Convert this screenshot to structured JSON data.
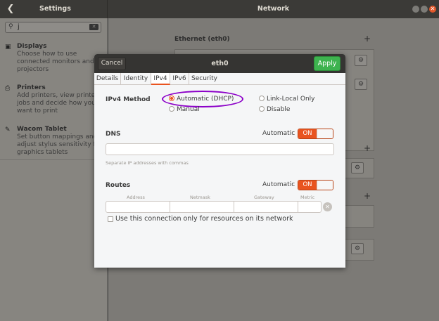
{
  "titlebar": {
    "settings_title": "Settings",
    "network_title": "Network",
    "back_icon": "chevron-left-icon"
  },
  "sidebar": {
    "search_value": "j",
    "items": [
      {
        "name": "Displays",
        "desc": "Choose how to use\nconnected monitors and\nprojectors",
        "icon": "display-icon"
      },
      {
        "name": "Printers",
        "desc": "Add printers, view printer\njobs and decide how you\nwant to print",
        "icon": "printer-icon"
      },
      {
        "name": "Wacom Tablet",
        "desc": "Set button mappings and\nadjust stylus sensitivity fo\ngraphics tablets",
        "icon": "tablet-icon"
      }
    ]
  },
  "main": {
    "ethernet_title": "Ethernet (eth0)",
    "add_symbol": "+"
  },
  "dialog": {
    "title": "eth0",
    "cancel_label": "Cancel",
    "apply_label": "Apply",
    "tabs": [
      "Details",
      "Identity",
      "IPv4",
      "IPv6",
      "Security"
    ],
    "active_tab": "IPv4",
    "ipv4_method_label": "IPv4 Method",
    "methods": {
      "automatic": "Automatic (DHCP)",
      "link_local": "Link-Local Only",
      "manual": "Manual",
      "disable": "Disable"
    },
    "selected_method": "Automatic (DHCP)",
    "dns": {
      "label": "DNS",
      "automatic_label": "Automatic",
      "toggle_label": "ON",
      "value": "",
      "hint": "Separate IP addresses with commas"
    },
    "routes": {
      "label": "Routes",
      "automatic_label": "Automatic",
      "toggle_label": "ON",
      "columns": [
        "Address",
        "Netmask",
        "Gateway",
        "Metric"
      ]
    },
    "only_local_label": "Use this connection only for resources on its network",
    "only_local_checked": false
  },
  "colors": {
    "accent": "#e95420",
    "apply_green": "#3eb34f",
    "highlight": "#8c00c8"
  }
}
